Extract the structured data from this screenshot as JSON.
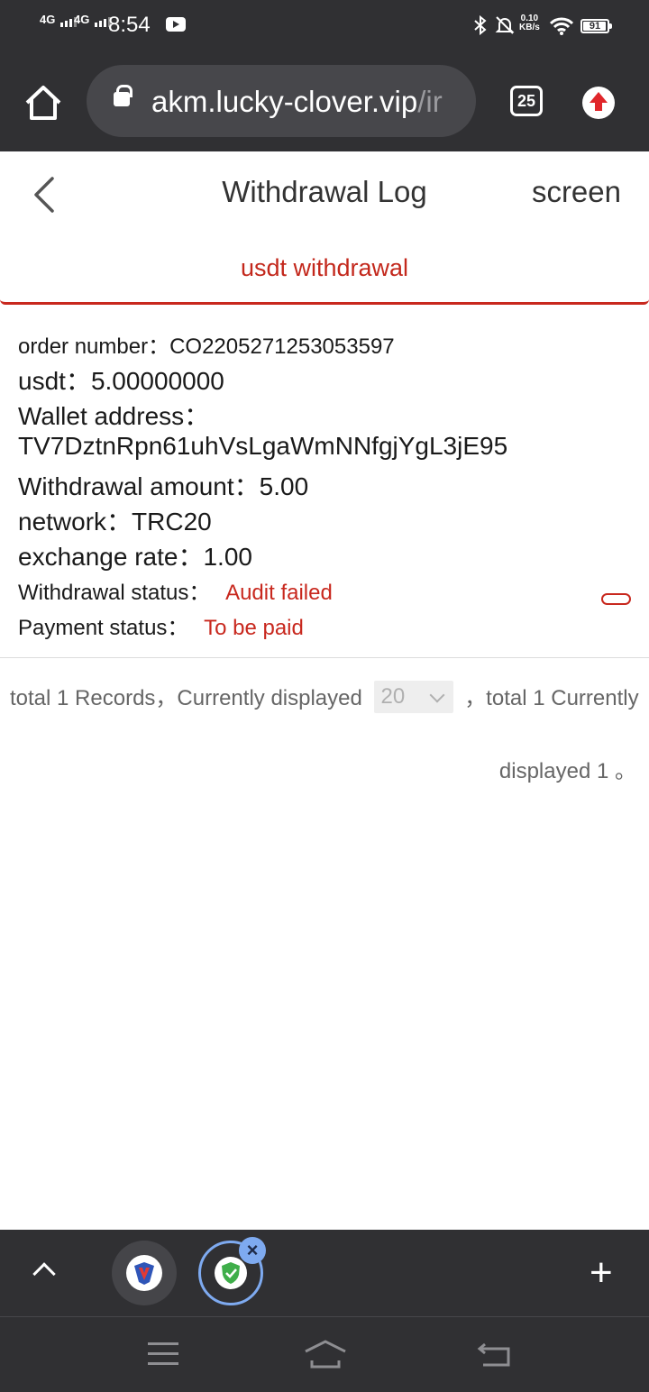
{
  "status_bar": {
    "signal1": "4G",
    "signal2": "4G",
    "time": "8:54",
    "net_speed_value": "0.10",
    "net_speed_unit": "KB/s",
    "battery": "91"
  },
  "browser": {
    "url_main": "akm.lucky-clover.vip",
    "url_rest": "/ir",
    "tab_count": "25"
  },
  "header": {
    "title": "Withdrawal Log",
    "screen_label": "screen"
  },
  "tabs": [
    {
      "label": "usdt withdrawal",
      "active": true
    }
  ],
  "record": {
    "order_label": "order number：",
    "order_value": "CO2205271253053597",
    "usdt_label": "usdt：",
    "usdt_value": "5.00000000",
    "wallet_label": "Wallet address：",
    "wallet_value": "TV7DztnRpn61uhVsLgaWmNNfgjYgL3jE95",
    "amount_label": "Withdrawal amount：",
    "amount_value": "5.00",
    "network_label": "network：",
    "network_value": "TRC20",
    "rate_label": "exchange rate：",
    "rate_value": "1.00",
    "wstatus_label": "Withdrawal status：",
    "wstatus_value": "Audit failed",
    "pstatus_label": "Payment status：",
    "pstatus_value": "To be paid"
  },
  "pagination": {
    "part1": "total 1 Records，Currently displayed",
    "page_size": "20",
    "part2": "，total 1 Currently",
    "part3": "displayed 1 。"
  },
  "bottom_bar": {
    "plus": "+",
    "close": "×"
  },
  "colors": {
    "accent": "#c8281e",
    "chrome": "#303033"
  }
}
